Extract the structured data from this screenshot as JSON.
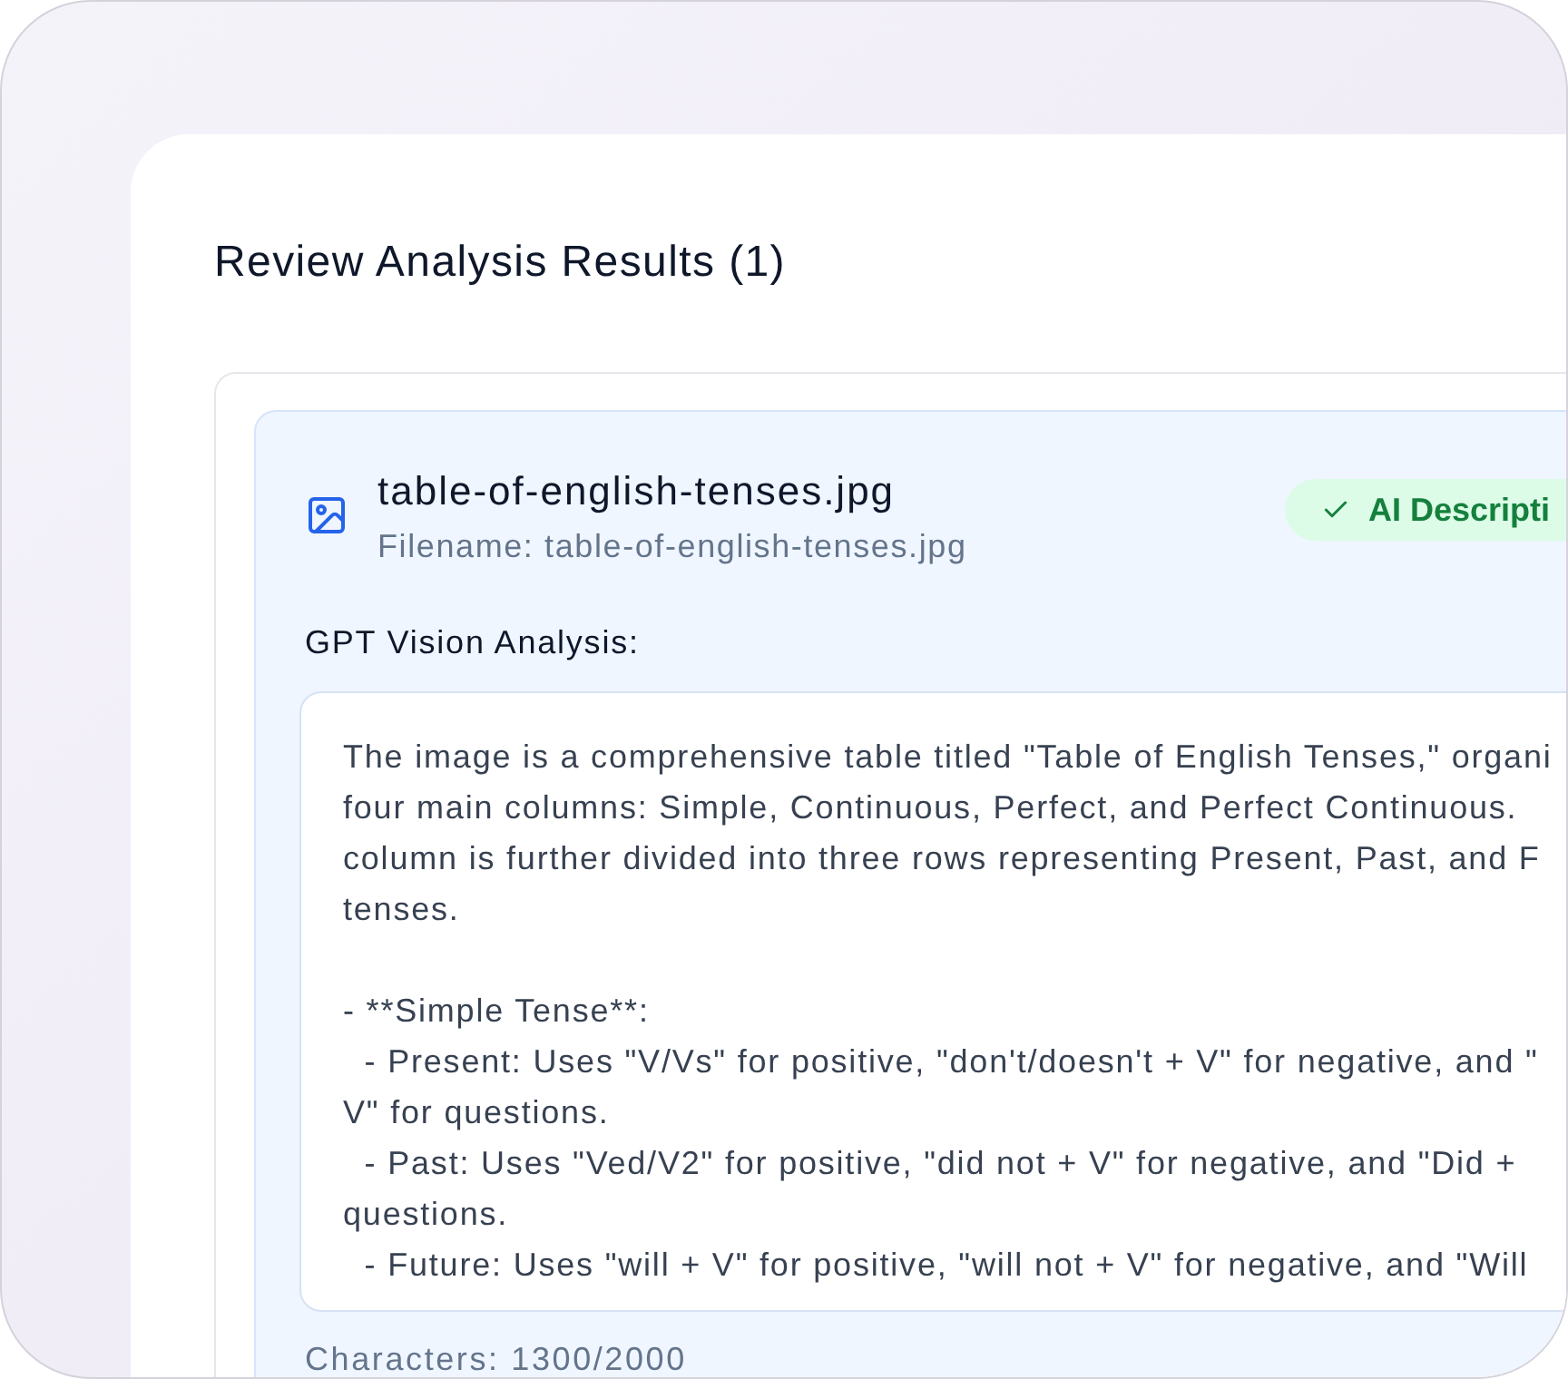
{
  "panel": {
    "title": "Review Analysis Results (1)"
  },
  "results": [
    {
      "file_title": "table-of-english-tenses.jpg",
      "filename": "Filename: table-of-english-tenses.jpg",
      "badge": {
        "label": "AI Descripti"
      },
      "analysis_label": "GPT Vision Analysis:",
      "analysis_text": "The image is a comprehensive table titled \"Table of English Tenses,\" organi\nfour main columns: Simple, Continuous, Perfect, and Perfect Continuous.\ncolumn is further divided into three rows representing Present, Past, and F\ntenses.\n\n- **Simple Tense**:\n  - Present: Uses \"V/Vs\" for positive, \"don't/doesn't + V\" for negative, and \"\nV\" for questions.\n  - Past: Uses \"Ved/V2\" for positive, \"did not + V\" for negative, and \"Did +\nquestions.\n  - Future: Uses \"will + V\" for positive, \"will not + V\" for negative, and \"Will",
      "char_count": "Characters: 1300/2000"
    }
  ]
}
